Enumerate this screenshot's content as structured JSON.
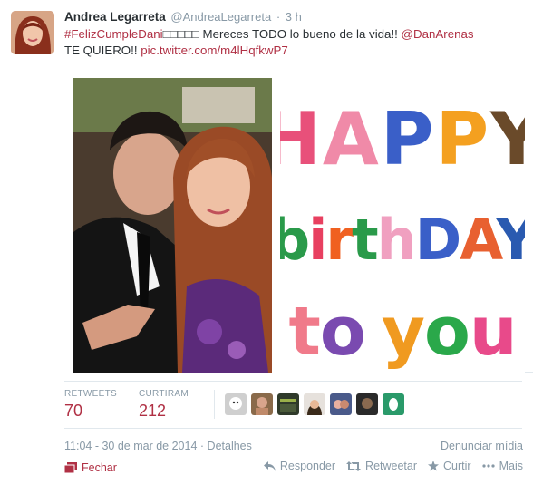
{
  "tweet": {
    "fullname": "Andrea Legarreta",
    "screenname": "@AndreaLegarreta",
    "separator": "·",
    "time": "3 h",
    "text_hashtag": "#FelizCumpleDani",
    "text_emoji": "□□□□□",
    "text_body": " Mereces TODO lo bueno de la vida!! ",
    "text_mention": "@DanArenas",
    "text_body2": "TE QUIERO!! ",
    "text_link": "pic.twitter.com/m4lHqfkwP7"
  },
  "image_card": {
    "line1": "HAPPY",
    "line2": "birthDAY",
    "line3": "to you"
  },
  "stats": {
    "retweets_label": "RETWEETS",
    "retweets_value": "70",
    "likes_label": "CURTIRAM",
    "likes_value": "212"
  },
  "meta": {
    "timestamp": "11:04 - 30 de mar de 2014",
    "separator": "·",
    "details": "Detalhes",
    "report": "Denunciar mídia"
  },
  "actions": {
    "close": "Fechar",
    "reply": "Responder",
    "retweet": "Retweetar",
    "favorite": "Curtir",
    "more": "Mais"
  },
  "colors": {
    "link": "#b03044",
    "muted": "#8899a6",
    "text": "#292f33"
  }
}
